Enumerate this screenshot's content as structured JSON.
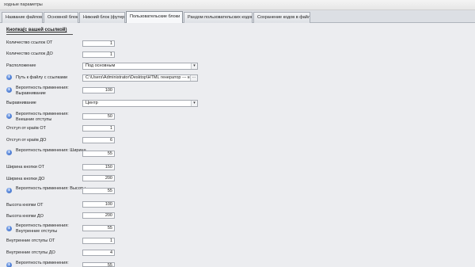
{
  "window": {
    "title": "ходные параметры"
  },
  "tabs": [
    {
      "label": "Название файлов"
    },
    {
      "label": "Основной блок"
    },
    {
      "label": "Нижний блок (футер)"
    },
    {
      "label": "Пользовательские блоки",
      "active": true
    },
    {
      "label": "Рандом пользовательских кодов"
    },
    {
      "label": "Сохранение кодов в файл"
    }
  ],
  "section": {
    "title": "Кнопка(с вашей ссылкой)"
  },
  "fields": {
    "links_from": {
      "label": "Количество ссылок ОТ",
      "value": "1"
    },
    "links_to": {
      "label": "Количество ссылок ДО",
      "value": "1"
    },
    "location": {
      "label": "Расположение",
      "value": "Под основным"
    },
    "links_file": {
      "label": "Путь к файлу с ссылками",
      "value": "C:\\Users\\Administrator\\Desktop\\HTML генератор --- ког"
    },
    "align_prob": {
      "label": "Вероятность применения: Выравнивание",
      "value": "100"
    },
    "align": {
      "label": "Выравнивание",
      "value": "Центр"
    },
    "outer_prob": {
      "label": "Вероятность применения: Внешние отступы",
      "value": "50"
    },
    "edge_from": {
      "label": "Отступ от краёв ОТ",
      "value": "1"
    },
    "edge_to": {
      "label": "Отступ от краёв ДО",
      "value": "6"
    },
    "width_prob": {
      "label": "Вероятность применения: Ширина",
      "value": "55"
    },
    "width_from": {
      "label": "Ширина кнопки ОТ",
      "value": "150"
    },
    "width_to": {
      "label": "Ширина кнопки ДО",
      "value": "200"
    },
    "height_prob": {
      "label": "Вероятность применения: Высоты",
      "value": "55"
    },
    "height_from": {
      "label": "Высота кнопки ОТ",
      "value": "100"
    },
    "height_to": {
      "label": "Высота кнопки ДО",
      "value": "200"
    },
    "inner_prob": {
      "label": "Вероятность применения: Внутренние отступы",
      "value": "55"
    },
    "inner_from": {
      "label": "Внутренние отступы ОТ",
      "value": "1"
    },
    "inner_to": {
      "label": "Внутренние отступы ДО",
      "value": "4"
    },
    "last_prob": {
      "label": "Вероятность применения:",
      "value": "55"
    }
  },
  "icons": {
    "info": "info-icon",
    "dropdown": "chevron-down-icon",
    "browse": "ellipsis-icon"
  }
}
